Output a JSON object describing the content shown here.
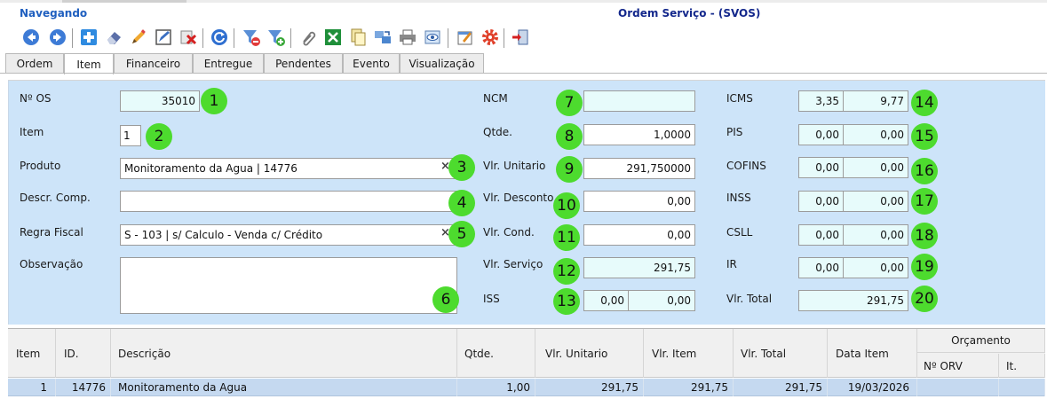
{
  "status": "Navegando",
  "window_title": "Ordem Serviço - (SVOS)",
  "toolbar": {
    "buttons": [
      {
        "name": "back-button",
        "icon": "arrow-left-icon"
      },
      {
        "name": "forward-button",
        "icon": "arrow-right-icon"
      },
      {
        "name": "new-button",
        "icon": "plus-icon"
      },
      {
        "name": "erase-button",
        "icon": "eraser-icon"
      },
      {
        "name": "edit-button",
        "icon": "pencil-icon"
      },
      {
        "name": "edit-form-button",
        "icon": "form-edit-icon"
      },
      {
        "name": "delete-button",
        "icon": "delete-x-icon"
      },
      {
        "name": "refresh-button",
        "icon": "refresh-icon"
      },
      {
        "name": "filter-remove-button",
        "icon": "filter-minus-icon"
      },
      {
        "name": "filter-add-button",
        "icon": "filter-plus-icon"
      },
      {
        "name": "attach-button",
        "icon": "paperclip-icon"
      },
      {
        "name": "excel-button",
        "icon": "excel-icon"
      },
      {
        "name": "copy-button",
        "icon": "copy-icon"
      },
      {
        "name": "transfer-button",
        "icon": "transfer-icon"
      },
      {
        "name": "print-button",
        "icon": "printer-icon"
      },
      {
        "name": "preview-button",
        "icon": "eye-icon"
      },
      {
        "name": "approve-button",
        "icon": "checklist-icon"
      },
      {
        "name": "settings-button",
        "icon": "gear-icon"
      },
      {
        "name": "exit-button",
        "icon": "exit-door-icon"
      }
    ]
  },
  "tabs": [
    {
      "label": "Ordem",
      "active": false
    },
    {
      "label": "Item",
      "active": true
    },
    {
      "label": "Financeiro",
      "active": false
    },
    {
      "label": "Entregue",
      "active": false
    },
    {
      "label": "Pendentes",
      "active": false
    },
    {
      "label": "Evento",
      "active": false
    },
    {
      "label": "Visualização",
      "active": false
    }
  ],
  "form": {
    "os_number": {
      "label": "Nº OS",
      "value": "35010"
    },
    "item": {
      "label": "Item",
      "value": "1"
    },
    "produto": {
      "label": "Produto",
      "value": "Monitoramento da Agua | 14776"
    },
    "descr_comp": {
      "label": "Descr. Comp.",
      "value": ""
    },
    "regra_fiscal": {
      "label": "Regra Fiscal",
      "value": "S - 103 | s/ Calculo - Venda c/ Crédito"
    },
    "observacao": {
      "label": "Observação",
      "value": ""
    },
    "ncm": {
      "label": "NCM",
      "value": ""
    },
    "qtde": {
      "label": "Qtde.",
      "value": "1,0000"
    },
    "vlr_unitario": {
      "label": "Vlr. Unitario",
      "value": "291,750000"
    },
    "vlr_desconto": {
      "label": "Vlr. Desconto",
      "value": "0,00"
    },
    "vlr_cond": {
      "label": "Vlr. Cond.",
      "value": "0,00"
    },
    "vlr_servico": {
      "label": "Vlr. Serviço",
      "value": "291,75"
    },
    "iss": {
      "label": "ISS",
      "rate": "0,00",
      "value": "0,00"
    },
    "icms": {
      "label": "ICMS",
      "rate": "3,35",
      "value": "9,77"
    },
    "pis": {
      "label": "PIS",
      "rate": "0,00",
      "value": "0,00"
    },
    "cofins": {
      "label": "COFINS",
      "rate": "0,00",
      "value": "0,00"
    },
    "inss": {
      "label": "INSS",
      "rate": "0,00",
      "value": "0,00"
    },
    "csll": {
      "label": "CSLL",
      "rate": "0,00",
      "value": "0,00"
    },
    "ir": {
      "label": "IR",
      "rate": "0,00",
      "value": "0,00"
    },
    "vlr_total": {
      "label": "Vlr. Total",
      "value": "291,75"
    },
    "clear_symbol": "×"
  },
  "badges": [
    "1",
    "2",
    "3",
    "4",
    "5",
    "6",
    "7",
    "8",
    "9",
    "10",
    "11",
    "12",
    "13",
    "14",
    "15",
    "16",
    "17",
    "18",
    "19",
    "20"
  ],
  "badge_color": "#4ddb2e",
  "grid": {
    "columns": {
      "item": "Item",
      "id": "ID.",
      "descricao": "Descrição",
      "qtde": "Qtde.",
      "vlr_unitario": "Vlr. Unitario",
      "vlr_item": "Vlr. Item",
      "vlr_total": "Vlr. Total",
      "data_item": "Data Item",
      "orcamento": "Orçamento",
      "orv": "Nº ORV",
      "it": "It."
    },
    "rows": [
      {
        "item": "1",
        "id": "14776",
        "descricao": "Monitoramento da Agua",
        "qtde": "1,00",
        "vlr_unitario": "291,75",
        "vlr_item": "291,75",
        "vlr_total": "291,75",
        "data_item": "19/03/2026",
        "orv": "",
        "it": ""
      }
    ]
  },
  "colors": {
    "form_background": "#cde4f9",
    "readonly_field": "#e7fbfb",
    "selected_row": "#c5d9f0",
    "status_text": "#1f5fbf",
    "title_text": "#14288c"
  }
}
